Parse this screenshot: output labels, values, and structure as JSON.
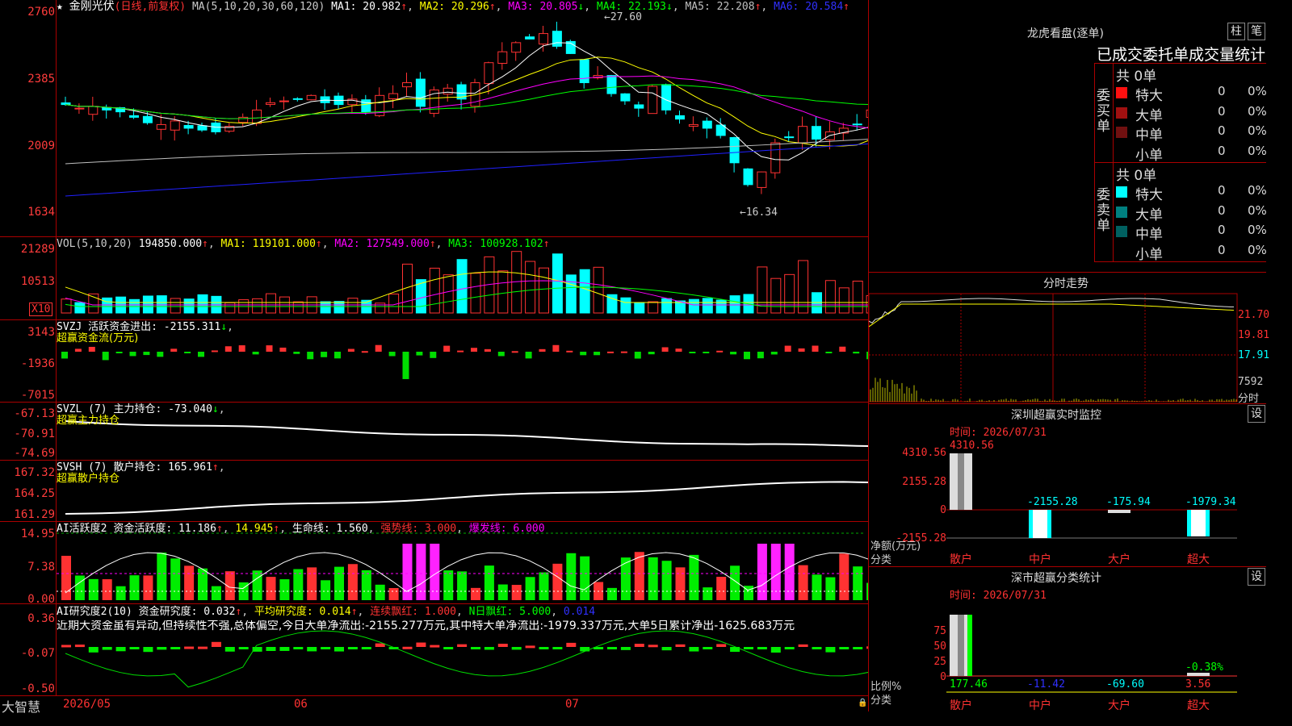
{
  "stock": {
    "name": "金刚光伏",
    "mode": "(日线,前复权)",
    "ma_label": "MA(5,10,20,30,60,120)",
    "ma1": "MA1: 20.982",
    "ma2": "MA2: 20.296",
    "ma3": "MA3: 20.805",
    "ma4": "MA4: 22.193",
    "ma5": "MA5: 22.208",
    "ma6": "MA6: 20.584",
    "high_mark": "27.60",
    "low_mark": "16.34",
    "axis": [
      "2760",
      "2385",
      "2009",
      "1634"
    ]
  },
  "vol": {
    "label": "VOL(5,10,20)",
    "v": "194850.000",
    "ma1": "MA1: 119101.000",
    "ma2": "MA2: 127549.000",
    "ma3": "MA3: 100928.102",
    "unit": "X10",
    "axis": [
      "21289",
      "10513"
    ]
  },
  "svzj": {
    "label": "SVZJ",
    "text": "活跃资金进出: -2155.311",
    "sub": "超赢资金流(万元)",
    "axis": [
      "3143",
      "-1936",
      "-7015"
    ]
  },
  "svzl": {
    "label": "SVZL (7)",
    "text": "主力持仓: -73.040",
    "sub": "超赢主力持仓",
    "axis": [
      "-67.13",
      "-70.91",
      "-74.69"
    ]
  },
  "svsh": {
    "label": "SVSH (7)",
    "text": "散户持仓: 165.961",
    "sub": "超赢散户持仓",
    "axis": [
      "167.32",
      "164.25",
      "161.29"
    ]
  },
  "ai1": {
    "label": "AI活跃度2",
    "t1": "资金活跃度: 11.186",
    "t2": "14.945",
    "t3": "生命线: 1.560",
    "t4": "强势线: 3.000",
    "t5": "爆发线: 6.000",
    "axis": [
      "14.95",
      "7.38",
      "0.00"
    ]
  },
  "ai2": {
    "label": "AI研究度2(10)",
    "t1": "资金研究度: 0.032",
    "t2": "平均研究度: 0.014",
    "t3": "连续飘红: 1.000",
    "t4": "N日飘红: 5.000",
    "t5": "0.014",
    "comment": "近期大资金虽有异动,但持续性不强,总体偏空,今日大单净流出:-2155.277万元,其中特大单净流出:-1979.337万元,大单5日累计净出-1625.683万元",
    "axis": [
      "0.36",
      "-0.07",
      "-0.50"
    ]
  },
  "footer": {
    "brand": "大智慧",
    "d1": "2026/05",
    "d2": "06",
    "d3": "07"
  },
  "right": {
    "lhb_title": "龙虎看盘(逐单)",
    "btn1": "柱",
    "btn2": "笔",
    "stat_title": "已成交委托单成交量统计",
    "buy_side": "委买单",
    "sell_side": "委卖单",
    "buy_total": "共 0单",
    "sell_total": "共 0单",
    "rows": [
      {
        "n": "特大",
        "v": "0",
        "p": "0%"
      },
      {
        "n": "大单",
        "v": "0",
        "p": "0%"
      },
      {
        "n": "中单",
        "v": "0",
        "p": "0%"
      },
      {
        "n": "小单",
        "v": "0",
        "p": "0%"
      }
    ],
    "intraday_title": "分时走势",
    "intra_axis": [
      "21.70",
      "19.81",
      "17.91",
      "7592",
      "分时"
    ],
    "sz_title": "深圳超赢实时监控",
    "set1": "设",
    "time1": "时间: 2026/07/31",
    "sz_axis": [
      "4310.56",
      "2155.28",
      "0",
      "-2155.28"
    ],
    "sz_vals": [
      "4310.56",
      "-2155.28",
      "-175.94",
      "-1979.34"
    ],
    "unit1": "净额(万元)",
    "cls": "分类",
    "cats": [
      "散户",
      "中户",
      "大户",
      "超大"
    ],
    "sc_title": "深市超赢分类统计",
    "set2": "设",
    "time2": "时间: 2026/07/31",
    "sc_axis": [
      "75",
      "50",
      "25",
      "0"
    ],
    "sc_vals": [
      "177.46",
      "-11.42",
      "-69.60",
      "3.56"
    ],
    "sc_extra": "-0.38%",
    "unit2": "比例%"
  },
  "colors": {
    "up": "#ff3232",
    "down": "#00ffff",
    "ma_white": "#ffffff",
    "ma_yellow": "#ffff00",
    "ma_magenta": "#ff00ff",
    "ma_green": "#00ff00",
    "ma_gray": "#c0c0c0",
    "ma_blue": "#2020ff",
    "grid": "#aa0000"
  }
}
